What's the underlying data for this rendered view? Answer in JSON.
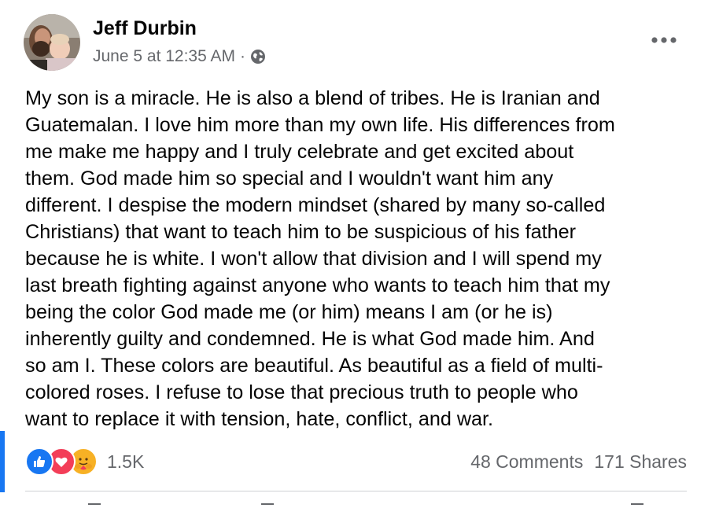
{
  "post": {
    "author": "Jeff Durbin",
    "timestamp": "June 5 at 12:35 AM",
    "separator": "·",
    "privacy_icon": "globe-icon",
    "more_icon": "more-options-icon",
    "text": "My son is a miracle. He is also a blend of tribes. He is Iranian and\nGuatemalan. I love him more than my own life. His differences from\nme make me happy and I truly celebrate and get excited about\nthem. God made him so special and I wouldn't want him any\ndifferent. I despise the modern mindset (shared by many so-called\nChristians) that want to teach him to be suspicious of his father\nbecause he is white. I won't allow that division and I will spend my\nlast breath fighting against anyone who wants to teach him that my\nbeing the color God made me (or him) means I am (or he is)\ninherently guilty and condemned. He is what God made him. And\nso am I. These colors are beautiful. As beautiful as a field of multi-\ncolored roses. I refuse to lose that precious truth to people who\nwant to replace it with tension, hate, conflict, and war."
  },
  "engagement": {
    "reaction_icons": [
      "like-icon",
      "love-icon",
      "care-icon"
    ],
    "reactions_count": "1.5K",
    "comments": "48 Comments",
    "shares": "171 Shares"
  },
  "colors": {
    "accent": "#1877f2",
    "love": "#f33e58",
    "care": "#f7b125",
    "secondary_text": "#65676b"
  }
}
